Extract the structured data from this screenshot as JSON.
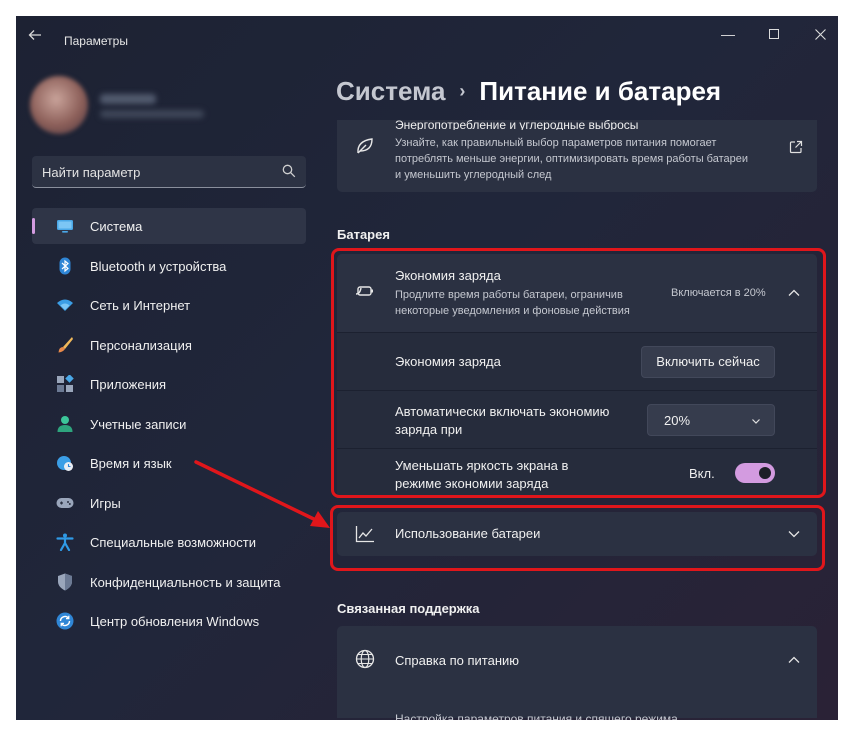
{
  "window": {
    "title": "Параметры"
  },
  "title_controls": {
    "back_icon": "arrow-left-icon",
    "minimize_glyph": "—",
    "maximize_glyph": "☐",
    "close_glyph": "✕"
  },
  "search": {
    "placeholder": "Найти параметр",
    "icon": "search-icon"
  },
  "sidebar": {
    "items": [
      {
        "label": "Система",
        "icon": "monitor-icon",
        "active": true
      },
      {
        "label": "Bluetooth и устройства",
        "icon": "bluetooth-icon"
      },
      {
        "label": "Сеть и Интернет",
        "icon": "wifi-icon"
      },
      {
        "label": "Персонализация",
        "icon": "brush-icon"
      },
      {
        "label": "Приложения",
        "icon": "apps-icon"
      },
      {
        "label": "Учетные записи",
        "icon": "user-icon"
      },
      {
        "label": "Время и язык",
        "icon": "globe-clock-icon"
      },
      {
        "label": "Игры",
        "icon": "gamepad-icon"
      },
      {
        "label": "Специальные возможности",
        "icon": "accessibility-icon"
      },
      {
        "label": "Конфиденциальность и защита",
        "icon": "shield-icon"
      },
      {
        "label": "Центр обновления Windows",
        "icon": "update-icon"
      }
    ]
  },
  "breadcrumb": {
    "parent": "Система",
    "separator": "›",
    "current": "Питание и батарея"
  },
  "energy_card": {
    "title": "Энергопотребление и углеродные выбросы",
    "description": "Узнайте, как правильный выбор параметров питания помогает потреблять меньше энергии, оптимизировать время работы батареи и уменьшить углеродный след",
    "icon": "leaf-icon",
    "link_icon": "external-link-icon"
  },
  "battery_section": {
    "title": "Батарея",
    "saver": {
      "title": "Экономия заряда",
      "description": "Продлите время работы батареи, ограничив некоторые уведомления и фоновые действия",
      "status": "Включается в 20%",
      "icon": "battery-saver-icon",
      "expanded": true
    },
    "rows": {
      "saver_now_label": "Экономия заряда",
      "saver_now_button": "Включить сейчас",
      "auto_label": "Автоматически включать экономию заряда при",
      "auto_value": "20%",
      "brightness_label": "Уменьшать яркость экрана в режиме экономии заряда",
      "brightness_state": "Вкл.",
      "brightness_on": true
    },
    "usage": {
      "label": "Использование батареи",
      "icon": "chart-line-icon"
    }
  },
  "support_section": {
    "title": "Связанная поддержка",
    "help": {
      "label": "Справка по питанию",
      "icon": "globe-icon",
      "sub": "Настройка параметров питания и спящего режима"
    }
  },
  "colors": {
    "accent": "#d39be0",
    "highlight": "#e0161b",
    "background": "#20263a",
    "card": "#2b3142"
  }
}
